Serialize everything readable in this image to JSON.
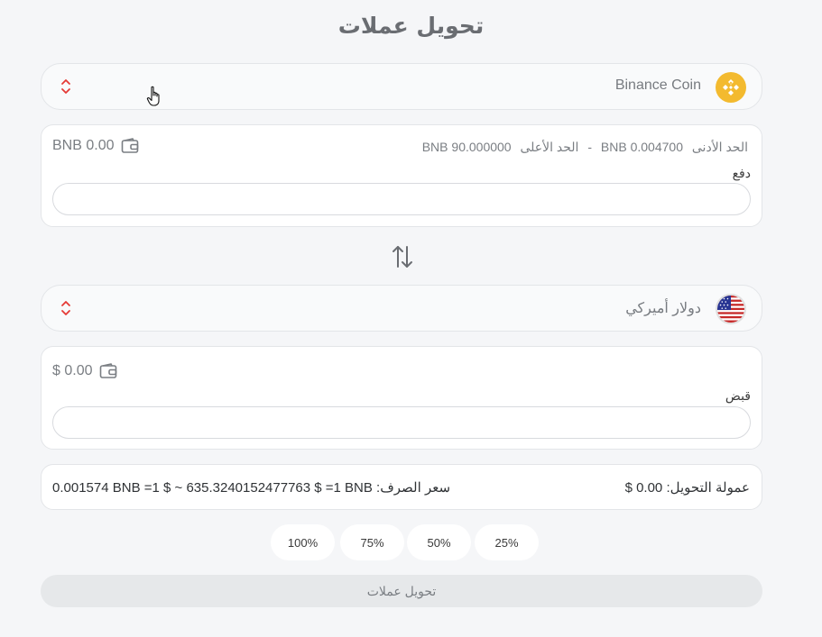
{
  "title": "تحويل عملات",
  "from": {
    "coin_name": "Binance Coin",
    "coin_icon": "bnb-icon",
    "min_label": "الحد الأدنى",
    "min_value": "0.004700 BNB",
    "separator": "-",
    "max_label": "الحد الأعلى",
    "max_value": "90.000000 BNB",
    "balance": "BNB 0.00",
    "field_label": "دفع",
    "input_value": ""
  },
  "swap_icon": "swap-vertical-icon",
  "to": {
    "coin_name": "دولار أميركي",
    "coin_icon": "us-flag-icon",
    "balance": "$ 0.00",
    "field_label": "قبض",
    "input_value": ""
  },
  "info": {
    "fee": "عمولة التحويل: 0.00 $",
    "rate": "0.001574 BNB =1 $ ~ 635.3240152477763 $ =1 BNB :سعر الصرف"
  },
  "percent_buttons": [
    "25%",
    "50%",
    "75%",
    "100%"
  ],
  "convert_button": "تحويل عملات",
  "colors": {
    "accent_red": "#e53935",
    "bnb_yellow": "#f3ba2f"
  }
}
